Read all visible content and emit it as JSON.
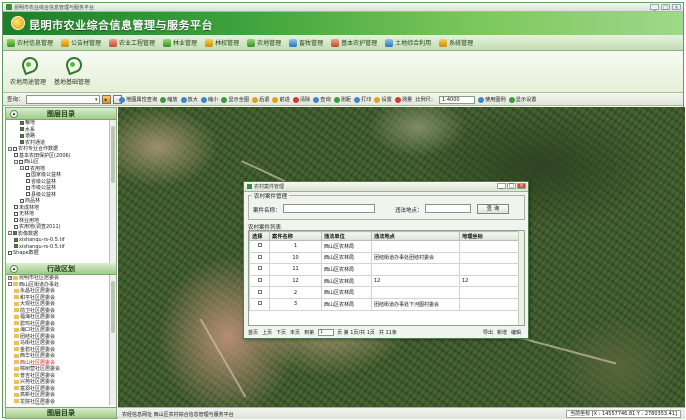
{
  "window": {
    "title": "昆明市农业综合信息管理与服务平台",
    "controls": [
      "_",
      "□",
      "×"
    ]
  },
  "banner": {
    "title": "昆明市农业综合信息管理与服务平台"
  },
  "main_menu": [
    {
      "label": "农村信息管理",
      "icon": "folder-icon"
    },
    {
      "label": "公告材管理",
      "icon": "document-icon"
    },
    {
      "label": "农业工程管理",
      "icon": "tractor-icon"
    },
    {
      "label": "林业管理",
      "icon": "tree-icon"
    },
    {
      "label": "林权管理",
      "icon": "certificate-icon"
    },
    {
      "label": "农地管理",
      "icon": "field-icon"
    },
    {
      "label": "畜牧管理",
      "icon": "livestock-icon"
    },
    {
      "label": "基本农护管理",
      "icon": "shield-icon"
    },
    {
      "label": "土地综合利用",
      "icon": "land-icon"
    },
    {
      "label": "系统管理",
      "icon": "gear-icon"
    }
  ],
  "ribbon": [
    {
      "label": "农地用途管理",
      "icon": "location-pin-icon"
    },
    {
      "label": "基地基础管理",
      "icon": "location-pin-icon"
    }
  ],
  "toolbar": {
    "search_label": "查询：",
    "search_value": "",
    "tools": [
      {
        "label": "地图属性查询",
        "icon": "info-icon"
      },
      {
        "label": "缩放",
        "icon": "pan-icon"
      },
      {
        "label": "放大",
        "icon": "zoom-in-icon"
      },
      {
        "label": "缩小",
        "icon": "zoom-out-icon"
      },
      {
        "label": "显示全图",
        "icon": "full-extent-icon"
      },
      {
        "label": "后退",
        "icon": "back-icon"
      },
      {
        "label": "前进",
        "icon": "forward-icon"
      },
      {
        "label": "清除",
        "icon": "clear-icon"
      },
      {
        "label": "查询",
        "icon": "query-icon"
      },
      {
        "label": "测距",
        "icon": "measure-icon"
      },
      {
        "label": "打印",
        "icon": "print-icon"
      },
      {
        "label": "设置",
        "icon": "settings-icon"
      },
      {
        "label": "测量",
        "icon": "ruler-icon"
      }
    ],
    "scale_label": "比例尺：",
    "scale_value": "1:4000",
    "right_tools": [
      {
        "label": "使用图例",
        "icon": "legend-icon"
      },
      {
        "label": "显示设置",
        "icon": "display-icon"
      }
    ]
  },
  "left_panel": {
    "top_title": "图层目录",
    "tree": [
      {
        "text": "粮地",
        "level": 3,
        "checked": true
      },
      {
        "text": "水系",
        "level": 3,
        "checked": true
      },
      {
        "text": "道路",
        "level": 3,
        "checked": true
      },
      {
        "text": "农村通道",
        "level": 3,
        "checked": true
      },
      {
        "text": "农村专业合作数据",
        "level": 1,
        "checked": false,
        "expander": "-"
      },
      {
        "text": "基本农田保护区(2006)",
        "level": 2,
        "checked": false
      },
      {
        "text": "西山区",
        "level": 2,
        "checked": false,
        "expander": "-"
      },
      {
        "text": "农用地",
        "level": 3,
        "checked": false,
        "expander": "-"
      },
      {
        "text": "国家级公益林",
        "level": 4,
        "checked": false
      },
      {
        "text": "省级公益林",
        "level": 4,
        "checked": false
      },
      {
        "text": "市级公益林",
        "level": 4,
        "checked": false
      },
      {
        "text": "县级公益林",
        "level": 4,
        "checked": false
      },
      {
        "text": "商品林",
        "level": 3,
        "checked": false
      },
      {
        "text": "未成林地",
        "level": 2,
        "checked": false
      },
      {
        "text": "无林地",
        "level": 2,
        "checked": false
      },
      {
        "text": "林业用地",
        "level": 2,
        "checked": false
      },
      {
        "text": "农用地(调查2011)",
        "level": 2,
        "checked": false
      },
      {
        "text": "影像数据",
        "level": 1,
        "checked": true,
        "expander": "-"
      },
      {
        "text": "xishanqu-rs-0.5.tif",
        "level": 2,
        "checked": true
      },
      {
        "text": "xishanqu-rs-0.5.tif",
        "level": 2,
        "checked": true
      },
      {
        "text": "Shape数据",
        "level": 1,
        "checked": false
      }
    ],
    "mid_title": "行政区划",
    "tree2": [
      {
        "text": "昆明市社区居委会",
        "level": 1,
        "expander": "+"
      },
      {
        "text": "西山区街道办事处",
        "level": 1,
        "expander": "-"
      },
      {
        "text": "永昌社区居委会",
        "level": 2
      },
      {
        "text": "和平社区居委会",
        "level": 2
      },
      {
        "text": "大观社区居委会",
        "level": 2
      },
      {
        "text": "前卫社区居委会",
        "level": 2
      },
      {
        "text": "福海社区居委会",
        "level": 2
      },
      {
        "text": "碧鸡社区居委会",
        "level": 2
      },
      {
        "text": "海口社区居委会",
        "level": 2
      },
      {
        "text": "团结社区居委会",
        "level": 2
      },
      {
        "text": "马街社区居委会",
        "level": 2
      },
      {
        "text": "金碧社区居委会",
        "level": 2
      },
      {
        "text": "西华社区居委会",
        "level": 2
      },
      {
        "text": "西山社区居委会",
        "level": 2,
        "red": true
      },
      {
        "text": "棕树营社区居委会",
        "level": 2
      },
      {
        "text": "普吉社区居委会",
        "level": 2
      },
      {
        "text": "兴苑社区居委会",
        "level": 2
      },
      {
        "text": "富源社区居委会",
        "level": 2
      },
      {
        "text": "高新社区居委会",
        "level": 2
      },
      {
        "text": "龙院社区居委会",
        "level": 2
      },
      {
        "text": "宝海社区居委会",
        "level": 2
      }
    ],
    "bottom_title": "图层目录"
  },
  "map": {
    "status_left": "农经信息网址 西山区农村综合信息管理与服务平台",
    "status_right": "当前坐标 [X : 14557746.81 Y : 2780353.41]"
  },
  "dialog": {
    "title": "农村案件管理",
    "fieldset_legend": "农村案件管理",
    "name_label": "案件名称：",
    "name_value": "",
    "location_label": "违法地点：",
    "location_value": "",
    "query_button": "查  询",
    "list_label": "农村案件列表",
    "columns": [
      "选择",
      "案件名称",
      "违法单位",
      "违法地点",
      "地理坐标"
    ],
    "rows": [
      [
        "",
        "1",
        "西山区农林局",
        "",
        ""
      ],
      [
        "",
        "10",
        "西山区农林局",
        "团结街道办事处团结村委会",
        ""
      ],
      [
        "",
        "11",
        "西山区农林局",
        "",
        ""
      ],
      [
        "",
        "12",
        "西山区农林局",
        "12",
        "12"
      ],
      [
        "",
        "2",
        "西山区农林局",
        "",
        ""
      ],
      [
        "",
        "3",
        "西山区农林局",
        "团结街道办事处下河图村委会",
        ""
      ]
    ],
    "pager": {
      "first": "首页",
      "prev": "上页",
      "next": "下页",
      "last": "末页",
      "goto_label": "到第",
      "goto_value": "1",
      "page_info": "页 第 1页/共 1页",
      "total": "共 11条",
      "export": "导出",
      "add": "新增",
      "edit": "编辑"
    }
  }
}
